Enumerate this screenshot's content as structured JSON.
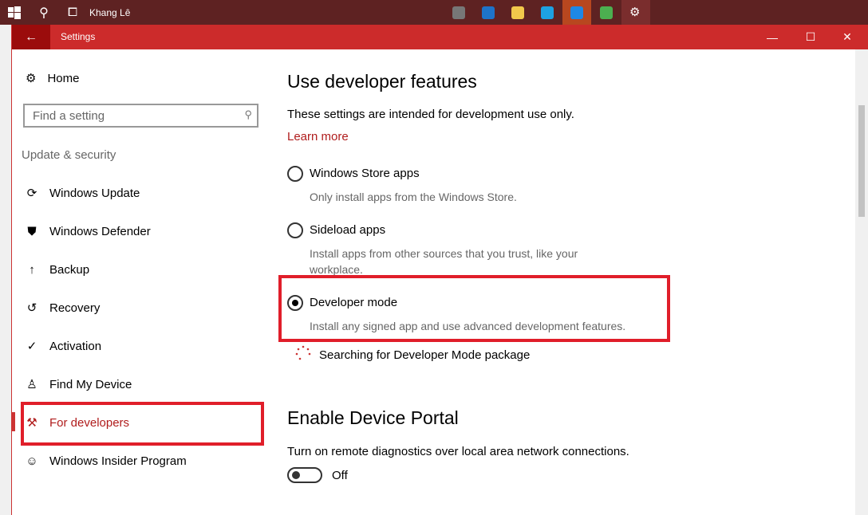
{
  "taskbar": {
    "user": "Khang Lê",
    "apps": [
      {
        "name": "tablet-app",
        "color": "#777777"
      },
      {
        "name": "edge",
        "color": "#1e73c9"
      },
      {
        "name": "file-explorer",
        "color": "#f2c84b"
      },
      {
        "name": "skype",
        "color": "#1da1e2"
      },
      {
        "name": "zalo",
        "color": "#1e88e5"
      },
      {
        "name": "chrome",
        "color": "#4caf50"
      },
      {
        "name": "settings",
        "color": "#ffffff"
      }
    ]
  },
  "window": {
    "title": "Settings",
    "minimize": "—",
    "maximize": "☐",
    "close": "✕"
  },
  "sidebar": {
    "home": "Home",
    "search_placeholder": "Find a setting",
    "category": "Update & security",
    "items": [
      {
        "label": "Windows Update",
        "icon": "⟳"
      },
      {
        "label": "Windows Defender",
        "icon": "⛊"
      },
      {
        "label": "Backup",
        "icon": "↑"
      },
      {
        "label": "Recovery",
        "icon": "↺"
      },
      {
        "label": "Activation",
        "icon": "✓"
      },
      {
        "label": "Find My Device",
        "icon": "♙"
      },
      {
        "label": "For developers",
        "icon": "⚒"
      },
      {
        "label": "Windows Insider Program",
        "icon": "☺"
      }
    ]
  },
  "main": {
    "title": "Use developer features",
    "intro": "These settings are intended for development use only.",
    "learn_more": "Learn more",
    "options": [
      {
        "label": "Windows Store apps",
        "desc": "Only install apps from the Windows Store.",
        "selected": false
      },
      {
        "label": "Sideload apps",
        "desc": "Install apps from other sources that you trust, like your workplace.",
        "selected": false
      },
      {
        "label": "Developer mode",
        "desc": "Install any signed app and use advanced development features.",
        "selected": true
      }
    ],
    "status": "Searching for Developer Mode package",
    "portal_title": "Enable Device Portal",
    "portal_desc": "Turn on remote diagnostics over local area network connections.",
    "portal_toggle": "Off"
  }
}
